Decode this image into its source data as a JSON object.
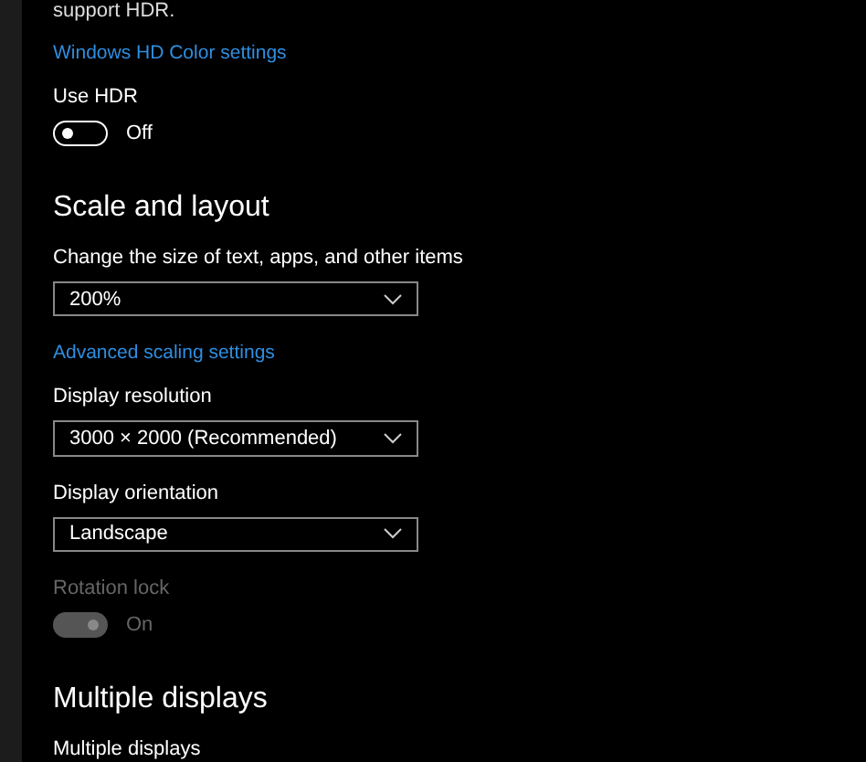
{
  "items": [
    {
      "kind": "text",
      "text": "support HDR."
    },
    {
      "kind": "link",
      "text": "Windows HD Color settings"
    },
    {
      "kind": "label",
      "text": "Use HDR"
    },
    {
      "kind": "toggle",
      "on": false,
      "disabled": false,
      "text": "Off"
    },
    {
      "kind": "heading",
      "text": "Scale and layout"
    },
    {
      "kind": "label",
      "text": "Change the size of text, apps, and other items"
    },
    {
      "kind": "dropdown",
      "value": "200%"
    },
    {
      "kind": "link",
      "text": "Advanced scaling settings"
    },
    {
      "kind": "label",
      "text": "Display resolution"
    },
    {
      "kind": "dropdown",
      "value": "3000 × 2000 (Recommended)"
    },
    {
      "kind": "label",
      "text": "Display orientation"
    },
    {
      "kind": "dropdown",
      "value": "Landscape"
    },
    {
      "kind": "label",
      "text": "Rotation lock",
      "disabled": true
    },
    {
      "kind": "toggle",
      "on": true,
      "disabled": true,
      "text": "On"
    },
    {
      "kind": "heading",
      "text": "Multiple displays"
    },
    {
      "kind": "label",
      "text": "Multiple displays"
    }
  ]
}
